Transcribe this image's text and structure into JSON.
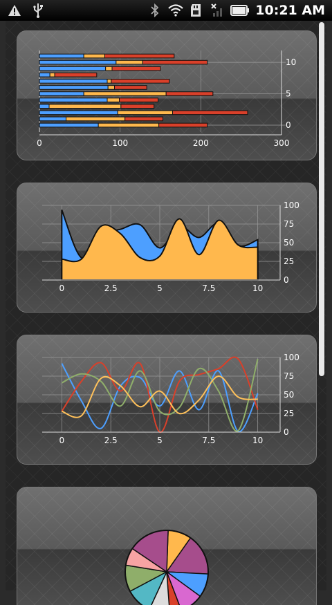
{
  "status_bar": {
    "time": "10:21 AM",
    "left_icons": [
      "warning-icon",
      "usb-icon"
    ],
    "right_icons": [
      "bluetooth-icon",
      "wifi-icon",
      "sd-card-icon",
      "signal-off-icon",
      "battery-icon"
    ]
  },
  "chart_data": [
    {
      "type": "bar",
      "orientation": "horizontal",
      "stacked": true,
      "categories": [
        "0",
        "1",
        "2",
        "3",
        "4",
        "5",
        "6",
        "7",
        "8",
        "9",
        "10",
        "11"
      ],
      "series": [
        {
          "values": [
            73,
            33,
            97,
            12,
            84,
            55,
            85,
            84,
            13,
            82,
            95,
            55
          ]
        },
        {
          "values": [
            75,
            73,
            68,
            89,
            15,
            102,
            8,
            5,
            6,
            8,
            33,
            26
          ]
        },
        {
          "values": [
            60,
            47,
            93,
            41,
            48,
            58,
            40,
            72,
            52,
            60,
            80,
            86
          ]
        }
      ],
      "colors": [
        "#4d9fff",
        "#ffb84d",
        "#d9402a"
      ],
      "xlim": [
        0,
        300
      ],
      "xticks": [
        0,
        100,
        200,
        300
      ],
      "ylim": [
        0,
        11
      ],
      "yticks": [
        0,
        5,
        10
      ],
      "grid": true
    },
    {
      "type": "area",
      "stacked": false,
      "x": [
        0,
        1,
        2,
        3,
        4,
        5,
        6,
        7,
        8,
        9,
        10
      ],
      "series": [
        {
          "values": [
            94,
            30,
            60,
            68,
            74,
            43,
            72,
            57,
            76,
            46,
            54
          ]
        },
        {
          "values": [
            28,
            28,
            72,
            62,
            30,
            32,
            82,
            34,
            80,
            47,
            44
          ]
        }
      ],
      "colors": [
        "#4d9fff",
        "#ffb84d"
      ],
      "xlim": [
        -1,
        11
      ],
      "xticks": [
        0,
        2.5,
        5,
        7.5,
        10
      ],
      "ylim": [
        0,
        100
      ],
      "yticks": [
        0,
        25,
        50,
        75,
        100
      ],
      "grid": true
    },
    {
      "type": "line",
      "x": [
        0,
        1,
        2,
        3,
        4,
        5,
        6,
        7,
        8,
        9,
        10
      ],
      "series": [
        {
          "values": [
            92,
            42,
            5,
            62,
            73,
            35,
            82,
            30,
            82,
            1,
            52
          ]
        },
        {
          "values": [
            28,
            68,
            93,
            55,
            92,
            0,
            68,
            77,
            85,
            98,
            30
          ]
        },
        {
          "values": [
            66,
            78,
            68,
            35,
            82,
            28,
            33,
            85,
            55,
            2,
            98
          ]
        },
        {
          "values": [
            28,
            22,
            72,
            62,
            34,
            55,
            25,
            43,
            75,
            47,
            44
          ]
        }
      ],
      "colors": [
        "#4d9fff",
        "#d9402a",
        "#8fae6a",
        "#ffc15a"
      ],
      "xlim": [
        -1,
        11
      ],
      "xticks": [
        0,
        2.5,
        5,
        7.5,
        10
      ],
      "ylim": [
        0,
        100
      ],
      "yticks": [
        0,
        25,
        50,
        75,
        100
      ],
      "grid": true
    },
    {
      "type": "pie",
      "values": [
        8,
        14,
        8,
        8,
        4,
        7,
        9,
        9,
        6,
        14
      ],
      "colors": [
        "#ffb84d",
        "#a64d8c",
        "#4d9fff",
        "#d968d0",
        "#d9402a",
        "#dcdcdc",
        "#53b8c5",
        "#8fae6a",
        "#f7a3a3",
        "#a64d8c"
      ],
      "start_angle_deg": -88
    }
  ]
}
